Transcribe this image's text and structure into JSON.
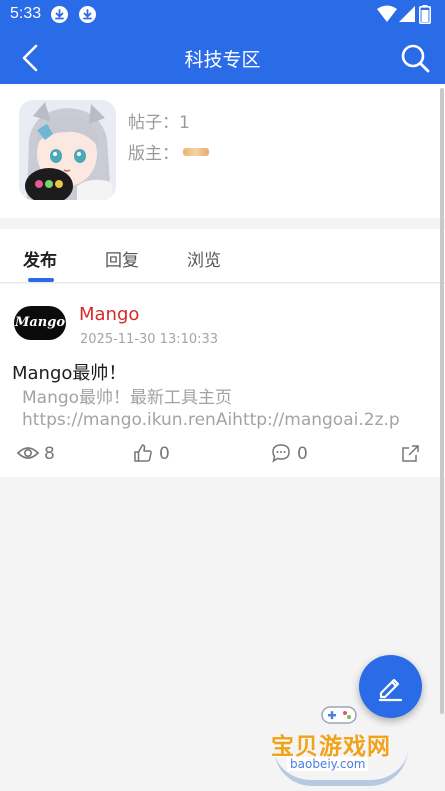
{
  "status_bar": {
    "time": "5:33"
  },
  "app_bar": {
    "title": "科技专区"
  },
  "forum": {
    "post_count": "帖子：1",
    "moderator_label": "版主："
  },
  "tabs": [
    {
      "label": "发布",
      "active": true
    },
    {
      "label": "回复",
      "active": false
    },
    {
      "label": "浏览",
      "active": false
    }
  ],
  "post": {
    "author_avatar_text": "Mango",
    "author": "Mango",
    "time": "2025-11-30 13:10:33",
    "title": "Mango最帅！",
    "excerpt_line1": "Mango最帅！最新工具主页",
    "excerpt_line2": "https://mango.ikun.renAihttp://mangoai.2z.p",
    "views": "8",
    "likes": "0",
    "comments": "0"
  },
  "watermark": {
    "text": "宝贝游戏网",
    "url": "baobeiy.com"
  },
  "colors": {
    "brand_blue": "#2a6be8",
    "author_red": "#d62a2a",
    "watermark_orange": "#f0a21b"
  },
  "icons": {
    "back": "chevron-left-icon",
    "search": "search-icon",
    "download": "download-icon",
    "wifi": "wifi-icon",
    "signal": "signal-icon",
    "battery": "battery-icon",
    "views": "eye-icon",
    "likes": "thumbs-up-icon",
    "comments": "comment-icon",
    "share": "share-icon",
    "compose": "pen-icon"
  }
}
